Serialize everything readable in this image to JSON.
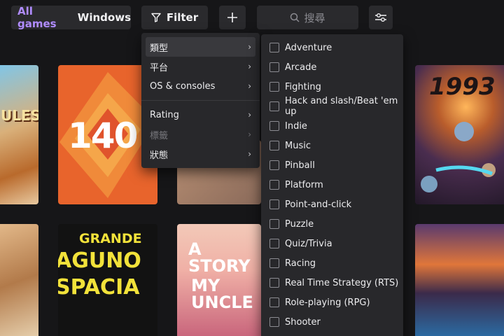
{
  "toolbar": {
    "all_games": "All games",
    "platform": "Windows",
    "filter_label": "Filter",
    "search_placeholder": "搜尋",
    "accent": "#b08cff"
  },
  "filter_menu": {
    "items": [
      {
        "label": "類型",
        "active": true
      },
      {
        "label": "平台"
      },
      {
        "label": "OS & consoles"
      },
      {
        "label": "Rating"
      },
      {
        "label": "標籤",
        "disabled": true
      },
      {
        "label": "狀態"
      }
    ]
  },
  "genre_menu": {
    "items": [
      "Adventure",
      "Arcade",
      "Fighting",
      "Hack and slash/Beat 'em up",
      "Indie",
      "Music",
      "Pinball",
      "Platform",
      "Point-and-click",
      "Puzzle",
      "Quiz/Trivia",
      "Racing",
      "Real Time Strategy (RTS)",
      "Role-playing (RPG)",
      "Shooter"
    ]
  },
  "tiles": {
    "t1": "ULES",
    "t2": "140",
    "t4": "1993",
    "t6a": "GRANDE",
    "t6b": "AGUNO",
    "t6c": "SPACIA",
    "t7a": "A STORY",
    "t7b": "MY UNCLE"
  }
}
